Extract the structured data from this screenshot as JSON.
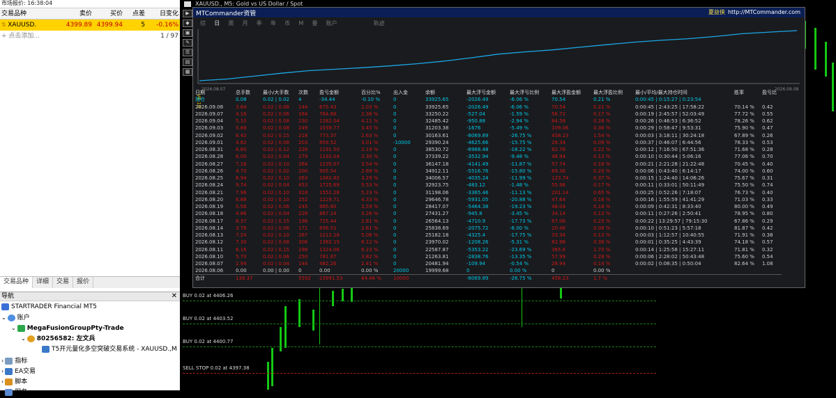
{
  "market_watch": {
    "title": "市场报价: 16:38:04",
    "headers": [
      "交易品种",
      "卖价",
      "买价",
      "点差",
      "日变化"
    ],
    "selected": {
      "symbol": "XAUUSD.",
      "bid": "4399.89",
      "ask": "4399.94",
      "spread": "5",
      "change": "-0.16%"
    },
    "add_label": "点击添加...",
    "count": "1 / 97",
    "tabs": [
      "交易品种",
      "详细",
      "交易",
      "报价"
    ]
  },
  "navigator": {
    "title": "导航",
    "items": [
      "STARTRADER Financial MT5",
      "账户",
      "MegaFusionGroupPty-Trade",
      "80256582: 左文兵",
      "T5开元量化多空突破交易系统 - XAUUSD.,M",
      "指标",
      "EA交易",
      "脚本",
      "服务"
    ]
  },
  "chart_window": {
    "title": "XAUUSD., M5:  Gold vs US Dollar / Spot",
    "left_tool_icons": [
      "▶",
      "◆",
      "▣",
      "✎",
      "☰",
      "▤",
      "▦"
    ],
    "orders": [
      "BUY 0.02 at 4406.26",
      "BUY 0.02 at 4403.52",
      "BUY 0.02 at 4400.77",
      "SELL STOP 0.02 at 4397.38"
    ]
  },
  "panel": {
    "brand": "MTCommander资管",
    "author_name": "夏益侠",
    "author_url": "http://MTCommander.com",
    "tabs": [
      "综",
      "日",
      "周",
      "月",
      "季",
      "年",
      "币",
      "M",
      "番",
      "账户"
    ],
    "active_tab": "日",
    "track_label": "轨迹",
    "equity_start_date": "2026.08.07",
    "equity_end_date": "2026.09.08",
    "version_label": "V8.18",
    "columns": [
      "日期",
      "总手数",
      "最小/大手数",
      "次数",
      "盈亏金额",
      "百分比%",
      "出入金",
      "余额",
      "最大浮亏金额",
      "最大浮亏比例",
      "最大浮盈金额",
      "最大浮盈比例",
      "最小/平均/最大持仓时间",
      "胜率",
      "盈亏比"
    ],
    "position_row": [
      "持仓",
      "0.08",
      "0.02 | 0.02",
      "4",
      "-34.44",
      "-0.10 %",
      "0",
      "33925.65",
      "-2026.49",
      "-6.06 %",
      "70.54",
      "0.21 %",
      "0:00:45 | 0:15:27 | 0:23:54",
      "",
      ""
    ],
    "rows": [
      [
        "2026.09.08",
        "3.84",
        "0.02 | 0.08",
        "144",
        "675.43",
        "2.03 %",
        "0",
        "33925.65",
        "-2026.49",
        "-6.06 %",
        "70.54",
        "0.21 %",
        "0:00:45 | 2:43:25 | 17:58:22",
        "70.14 %",
        "0.42"
      ],
      [
        "2026.09.07",
        "4.16",
        "0.02 | 0.06",
        "184",
        "764.68",
        "2.36 %",
        "0",
        "33250.22",
        "-527.04",
        "-1.59 %",
        "56.72",
        "0.17 %",
        "0:00:19 | 2:45:57 | 52:03:49",
        "77.72 %",
        "0.55"
      ],
      [
        "2026.09.04",
        "5.10",
        "0.02 | 0.08",
        "230",
        "1282.04",
        "4.11 %",
        "0",
        "32485.42",
        "-950.88",
        "-2.94 %",
        "84.58",
        "0.26 %",
        "0:00:26 | 0:46:53 | 6:36:52",
        "78.26 %",
        "0.62"
      ],
      [
        "2026.09.03",
        "5.88",
        "0.02 | 0.08",
        "249",
        "1039.77",
        "3.45 %",
        "0",
        "31203.38",
        "-1676",
        "-5.49 %",
        "109.06",
        "0.36 %",
        "0:00:29 | 0:58:47 | 9:53:31",
        "75.90 %",
        "0.47"
      ],
      [
        "2026.09.02",
        "6.42",
        "0.02 | 0.15",
        "218",
        "773.37",
        "2.63 %",
        "0",
        "30163.61",
        "-8069.89",
        "-26.75 %",
        "458.23",
        "1.54 %",
        "0:00:03 | 3:18:11 | 30:24:18",
        "67.89 %",
        "0.26"
      ],
      [
        "2026.09.01",
        "4.82",
        "0.02 | 0.08",
        "203",
        "859.52",
        "3.01 %",
        "-10000",
        "29390.24",
        "-4625.66",
        "-15.75 %",
        "26.34",
        "0.09 %",
        "0:00:37 | 0:46:07 | 6:44:56",
        "78.33 %",
        "0.53"
      ],
      [
        "2026.08.31",
        "6.60",
        "0.02 | 0.12",
        "226",
        "1191.50",
        "3.19 %",
        "0",
        "38530.72",
        "-6968.48",
        "-18.22 %",
        "82.76",
        "0.22 %",
        "0:00:12 | 7:16:50 | 67:51:36",
        "71.68 %",
        "0.28"
      ],
      [
        "2026.08.28",
        "6.00",
        "0.02 | 0.04",
        "279",
        "1192.04",
        "3.30 %",
        "0",
        "37339.22",
        "-3532.94",
        "-9.48 %",
        "48.94",
        "0.13 %",
        "0:00:10 | 0:30:44 | 5:06:16",
        "77.06 %",
        "0.70"
      ],
      [
        "2026.08.27",
        "7.16",
        "0.02 | 0.10",
        "264",
        "1235.07",
        "3.54 %",
        "0",
        "36147.18",
        "-4141.49",
        "-11.87 %",
        "57.74",
        "0.16 %",
        "0:00:21 | 2:21:28 | 21:22:48",
        "70.45 %",
        "0.40"
      ],
      [
        "2026.08.26",
        "4.70",
        "0.02 | 0.02",
        "200",
        "905.54",
        "2.69 %",
        "0",
        "34912.11",
        "-5516.76",
        "-15.80 %",
        "69.36",
        "0.20 %",
        "0:00:06 | 0:43:40 | 6:14:17",
        "74.00 %",
        "0.60"
      ],
      [
        "2026.08.25",
        "6.94",
        "0.02 | 0.10",
        "263",
        "1082.82",
        "3.29 %",
        "0",
        "34006.57",
        "-4035.24",
        "-11.99 %",
        "123.74",
        "0.37 %",
        "0:00:15 | 1:24:40 | 14:06:26",
        "75.67 %",
        "0.31"
      ],
      [
        "2026.08.24",
        "9.74",
        "0.02 | 0.04",
        "453",
        "1725.69",
        "5.53 %",
        "0",
        "32923.75",
        "-483.12",
        "-1.48 %",
        "55.98",
        "0.17 %",
        "0:00:11 | 0:33:01 | 50:11:49",
        "75.50 %",
        "0.74"
      ],
      [
        "2026.08.21",
        "7.96",
        "0.02 | 0.10",
        "318",
        "1551.28",
        "5.23 %",
        "0",
        "31198.06",
        "-3365.46",
        "-11.13 %",
        "201.14",
        "0.65 %",
        "0:00:25 | 0:52:26 | 7:18:07",
        "76.73 %",
        "0.40"
      ],
      [
        "2026.08.20",
        "6.88",
        "0.02 | 0.10",
        "252",
        "1229.71",
        "4.33 %",
        "0",
        "29646.78",
        "-5931.05",
        "-20.88 %",
        "47.64",
        "0.16 %",
        "0:00:16 | 1:55:59 | 41:41:29",
        "71.03 %",
        "0.33"
      ],
      [
        "2026.08.19",
        "5.56",
        "0.02 | 0.06",
        "245",
        "985.80",
        "3.59 %",
        "0",
        "28417.07",
        "-5464.38",
        "-19.23 %",
        "48.04",
        "0.18 %",
        "0:00:09 | 0:42:31 | 8:33:40",
        "80.00 %",
        "0.49"
      ],
      [
        "2026.08.18",
        "4.86",
        "0.02 | 0.04",
        "228",
        "867.14",
        "3.26 %",
        "0",
        "27431.27",
        "-945.8",
        "-3.45 %",
        "34.14",
        "0.13 %",
        "0:00:11 | 0:27:26 | 2:50:41",
        "78.95 %",
        "0.80"
      ],
      [
        "2026.08.17",
        "6.37",
        "0.02 | 0.15",
        "196",
        "725.44",
        "2.81 %",
        "0",
        "26564.13",
        "-4710.9",
        "-17.73 %",
        "67.06",
        "0.25 %",
        "0:00:22 | 13:29:57 | 79:15:30",
        "67.86 %",
        "0.29"
      ],
      [
        "2026.08.14",
        "3.76",
        "0.02 | 0.06",
        "171",
        "656.51",
        "2.61 %",
        "0",
        "25838.69",
        "-2075.72",
        "-8.00 %",
        "20.46",
        "0.08 %",
        "0:00:10 | 0:51:23 | 5:57:18",
        "81.87 %",
        "0.42"
      ],
      [
        "2026.08.13",
        "7.24",
        "0.02 | 0.10",
        "267",
        "1212.16",
        "5.06 %",
        "0",
        "25182.18",
        "-4325.4",
        "-17.75 %",
        "33.34",
        "0.13 %",
        "0:00:03 | 1:12:57 | 10:40:55",
        "71.91 %",
        "0.38"
      ],
      [
        "2026.08.12",
        "7.30",
        "0.02 | 0.08",
        "306",
        "1382.15",
        "6.12 %",
        "0",
        "23970.02",
        "-1208.26",
        "-5.31 %",
        "82.96",
        "0.36 %",
        "0:00:01 | 0:35:25 | 4:43:39",
        "74.18 %",
        "0.57"
      ],
      [
        "2026.08.11",
        "6.16",
        "0.02 | 0.15",
        "298",
        "1324.06",
        "6.23 %",
        "0",
        "22587.87",
        "-5353.22",
        "-23.69 %",
        "365.6",
        "1.70 %",
        "0:00:14 | 1:25:58 | 15:27:11",
        "71.81 %",
        "0.32"
      ],
      [
        "2026.08.10",
        "5.70",
        "0.02 | 0.06",
        "250",
        "781.87",
        "3.82 %",
        "0",
        "21263.81",
        "-2838.76",
        "-13.35 %",
        "57.99",
        "0.28 %",
        "0:00:06 | 2:28:02 | 50:43:48",
        "75.60 %",
        "0.54"
      ],
      [
        "2026.08.07",
        "2.94",
        "0.02 | 0.04",
        "144",
        "482.26",
        "2.41 %",
        "0",
        "20481.94",
        "-109.94",
        "-0.54 %",
        "28.94",
        "0.14 %",
        "0:00:02 | 0:08:35 | 0:50:04",
        "82.64 %",
        "1.08"
      ],
      [
        "2026.08.06",
        "0.00",
        "0.00 | 0.00",
        "0",
        "0.00",
        "0.00 %",
        "20000",
        "19999.68",
        "0",
        "0.00 %",
        "0",
        "0.00 %",
        "",
        "",
        ""
      ]
    ],
    "total_row": [
      "合计",
      "138.37",
      "",
      "5592",
      "23991.53",
      "84.46 %",
      "10000",
      "",
      "-8069.89",
      "-26.75 %",
      "458.23",
      "1.7 %",
      "",
      "",
      ""
    ],
    "equity_series": {
      "dates": [
        "2026.08.07",
        "2026.08.10",
        "2026.08.11",
        "2026.08.12",
        "2026.08.13",
        "2026.08.14",
        "2026.08.17",
        "2026.08.18",
        "2026.08.19",
        "2026.08.20",
        "2026.08.21",
        "2026.08.24",
        "2026.08.25",
        "2026.08.26",
        "2026.08.27",
        "2026.08.28",
        "2026.08.31",
        "2026.09.01",
        "2026.09.02",
        "2026.09.03",
        "2026.09.04",
        "2026.09.07",
        "2026.09.08"
      ],
      "values": [
        20481.94,
        21263.81,
        22587.87,
        23970.02,
        25182.18,
        25838.69,
        26564.13,
        27431.27,
        28417.07,
        29646.78,
        31198.06,
        32923.75,
        34006.57,
        34912.11,
        36147.18,
        37339.22,
        38530.72,
        39390.24,
        40163.61,
        41203.38,
        42485.42,
        43250.22,
        43925.65
      ]
    }
  },
  "colors": {
    "selected_row": "#ffd200",
    "panel_header": "#0b1f55",
    "profit": "#d01818",
    "loss": "#00c8e8",
    "candle": "#14c814"
  }
}
